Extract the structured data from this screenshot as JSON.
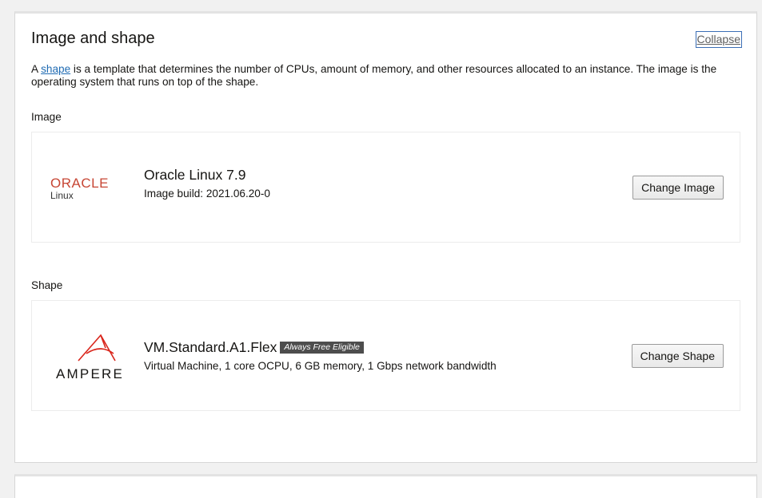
{
  "section": {
    "title": "Image and shape",
    "collapse_label": "Collapse",
    "description_prefix": "A ",
    "description_link": "shape",
    "description_rest": " is a template that determines the number of CPUs, amount of memory, and other resources allocated to an instance. The image is the operating system that runs on top of the shape."
  },
  "image": {
    "section_label": "Image",
    "logo_main": "ORACLE",
    "logo_sub": "Linux",
    "name": "Oracle Linux 7.9",
    "build": "Image build: 2021.06.20-0",
    "button_label": "Change Image"
  },
  "shape": {
    "section_label": "Shape",
    "logo_text": "AMPERE",
    "name": "VM.Standard.A1.Flex",
    "badge": "Always Free Eligible",
    "details": "Virtual Machine, 1 core OCPU, 6 GB memory, 1 Gbps network bandwidth",
    "button_label": "Change Shape"
  },
  "colors": {
    "oracle_red": "#c74634",
    "ampere_red": "#d9261c",
    "link_blue": "#1f6bb3"
  }
}
